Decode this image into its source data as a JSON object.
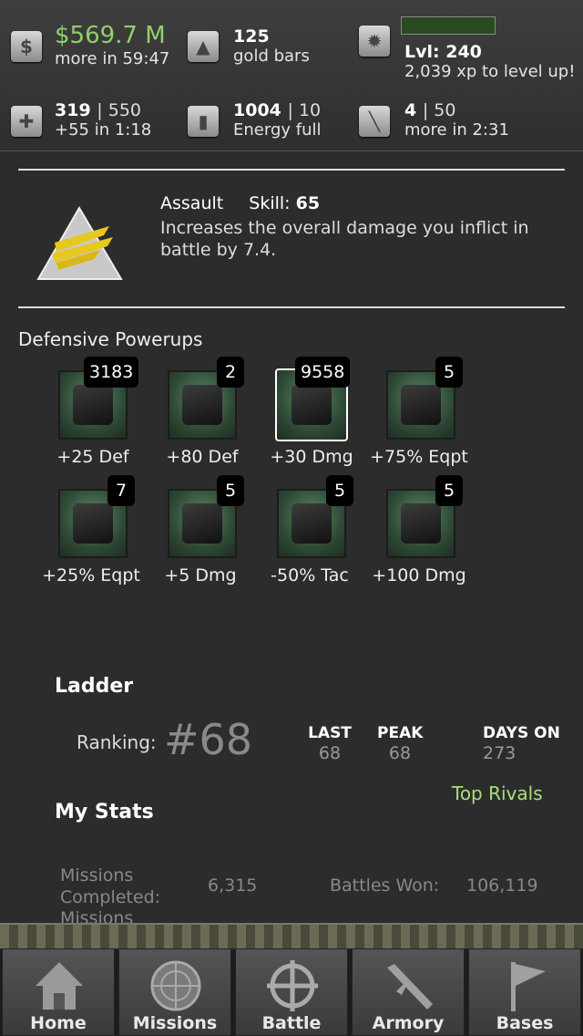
{
  "top": {
    "cash": "$569.7 M",
    "cash_timer": "more in 59:47",
    "gold": "125",
    "gold_label": "gold bars",
    "level": "Lvl: 240",
    "xp": "2,039 xp to level up!",
    "health_cur": "319",
    "health_max": "| 550",
    "health_regen": "+55 in 1:18",
    "energy_cur": "1004",
    "energy_max": "| 10",
    "energy_status": "Energy full",
    "stamina_cur": "4",
    "stamina_max": "| 50",
    "stamina_timer": "more in 2:31"
  },
  "skill": {
    "name": "Assault",
    "skill_label": "Skill:",
    "skill_value": "65",
    "desc_line1": "Increases the overall damage you inflict in",
    "desc_line2": "battle by 7.4."
  },
  "powerups": {
    "heading": "Defensive Powerups",
    "items": [
      {
        "count": "3183",
        "label": "+25 Def"
      },
      {
        "count": "2",
        "label": "+80 Def"
      },
      {
        "count": "9558",
        "label": "+30 Dmg"
      },
      {
        "count": "5",
        "label": "+75% Eqpt"
      },
      {
        "count": "7",
        "label": "+25% Eqpt"
      },
      {
        "count": "5",
        "label": "+5 Dmg"
      },
      {
        "count": "5",
        "label": "-50% Tac"
      },
      {
        "count": "5",
        "label": "+100 Dmg"
      }
    ]
  },
  "ladder": {
    "heading": "Ladder",
    "ranking_label": "Ranking:",
    "ranking_value": "#68",
    "last_label": "LAST",
    "last_value": "68",
    "peak_label": "PEAK",
    "peak_value": "68",
    "days_label": "DAYS ON",
    "days_value": "273",
    "rivals_link": "Top Rivals"
  },
  "mystats": {
    "heading": "My Stats",
    "missions_label1": "Missions",
    "missions_label2": "Completed:",
    "missions_value": "6,315",
    "battles_won_label": "Battles Won:",
    "battles_won_value": "106,119",
    "cut_label": "Missions"
  },
  "nav": {
    "home": "Home",
    "missions": "Missions",
    "battle": "Battle",
    "armory": "Armory",
    "bases": "Bases"
  },
  "colors": {
    "accent_green": "#8fd06a",
    "link_green": "#a6e07c",
    "background": "#2c2c2c"
  }
}
